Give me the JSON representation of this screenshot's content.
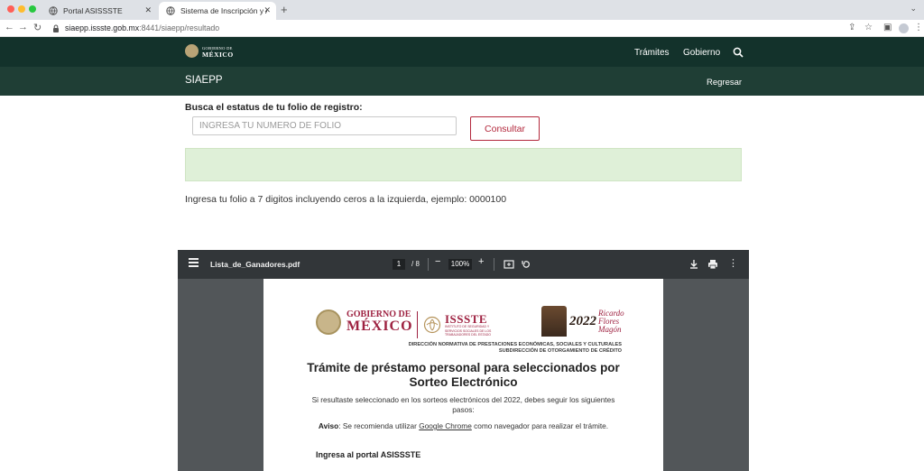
{
  "browser": {
    "tabs": [
      {
        "label": "Portal ASISSSTE",
        "active": false
      },
      {
        "label": "Sistema de Inscripción y Asign",
        "active": true
      }
    ],
    "url": {
      "host": "siaepp.issste.gob.mx",
      "path": ":8441/siaepp/resultado"
    },
    "colors": {
      "close": "#ff5f57",
      "minimize": "#febc2e",
      "maximize": "#28c840"
    }
  },
  "gob_header": {
    "logo_line1": "GOBIERNO DE",
    "logo_line2": "MÉXICO",
    "nav": [
      "Trámites",
      "Gobierno"
    ],
    "bg_color": "#13322b"
  },
  "app_bar": {
    "title": "SIAEPP",
    "back_link": "Regresar",
    "bg_color": "#1f3e35"
  },
  "form": {
    "label": "Busca el estatus de tu folio de registro:",
    "input_placeholder": "INGRESA TU NÚMERO DE FOLIO",
    "submit_label": "Consultar",
    "accent_color": "#b3283c",
    "alert_color": "#dff0d8",
    "hint": "Ingresa tu folio a 7 digitos incluyendo ceros a la izquierda, ejemplo: 0000100"
  },
  "pdf_viewer": {
    "filename": "Lista_de_Ganadores.pdf",
    "current_page": "1",
    "total_pages": "/ 8",
    "zoom": "100%",
    "document": {
      "gob_line1": "GOBIERNO DE",
      "gob_line2": "MÉXICO",
      "issste_name": "ISSSTE",
      "issste_subtitle": "INSTITUTO DE SEGURIDAD Y SERVICIOS SOCIALES DE LOS TRABAJADORES DEL ESTADO",
      "year_badge": "2022",
      "year_name": "Ricardo Flores Magón",
      "direction_line1": "DIRECCIÓN NORMATIVA DE PRESTACIONES ECONÓMICAS, SOCIALES Y CULTURALES",
      "direction_line2": "SUBDIRECCIÓN DE OTORGAMIENTO DE CRÉDITO",
      "title": "Trámite de préstamo personal para seleccionados por Sorteo Electrónico",
      "paragraph1": "Si resultaste seleccionado en los sorteos electrónicos del 2022, debes seguir los siguientes pasos:",
      "aviso_label": "Aviso",
      "aviso_pre": ": Se recomienda utilizar ",
      "aviso_link": "Google Chrome",
      "aviso_post": " como navegador para realizar el trámite.",
      "section_heading": "Ingresa al portal ASISSSTE"
    }
  }
}
